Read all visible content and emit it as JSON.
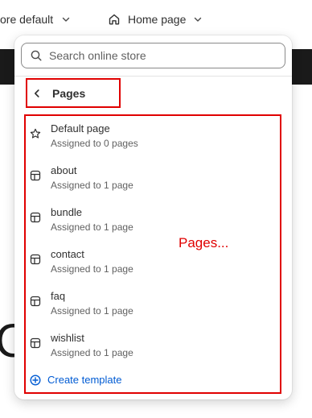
{
  "header": {
    "store_label": "ore default",
    "page_label": "Home page"
  },
  "popover": {
    "search": {
      "placeholder": "Search online store"
    },
    "back": {
      "label": "Pages"
    },
    "items": [
      {
        "title": "Default page",
        "subtitle": "Assigned to 0 pages",
        "icon": "star-icon"
      },
      {
        "title": "about",
        "subtitle": "Assigned to 1 page",
        "icon": "template-icon"
      },
      {
        "title": "bundle",
        "subtitle": "Assigned to 1 page",
        "icon": "template-icon"
      },
      {
        "title": "contact",
        "subtitle": "Assigned to 1 page",
        "icon": "template-icon"
      },
      {
        "title": "faq",
        "subtitle": "Assigned to 1 page",
        "icon": "template-icon"
      },
      {
        "title": "wishlist",
        "subtitle": "Assigned to 1 page",
        "icon": "template-icon"
      }
    ],
    "create": {
      "label": "Create template",
      "icon": "plus-circle-icon"
    }
  },
  "annotation": {
    "text": "Pages..."
  },
  "colors": {
    "annotation_red": "#e00000",
    "link_blue": "#005bd3",
    "text": "#303030",
    "subtext": "#616161"
  }
}
